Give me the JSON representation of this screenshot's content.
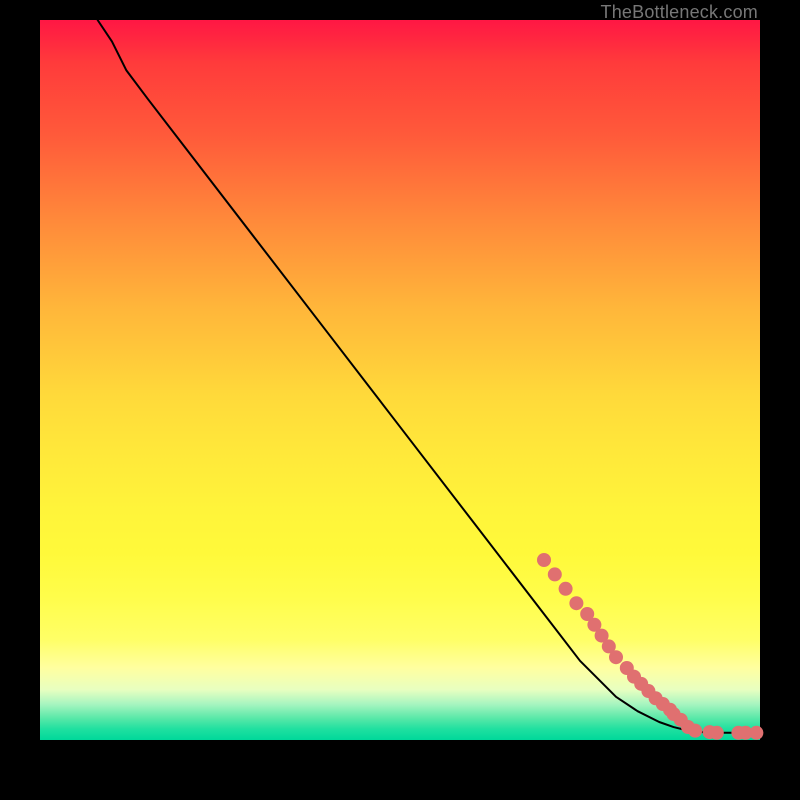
{
  "attribution": "TheBottleneck.com",
  "colors": {
    "dot": "#e07070",
    "curve": "#000000",
    "frame": "#000000"
  },
  "chart_data": {
    "type": "line",
    "title": "",
    "xlabel": "",
    "ylabel": "",
    "xlim": [
      0,
      100
    ],
    "ylim": [
      0,
      100
    ],
    "grid": false,
    "legend": false,
    "curve": {
      "description": "Monotone decreasing bottleneck curve starting near (8,100), slight shoulder near x≈11, then near-linear descent to elbow around (88,2), then flat along y≈1 to x=100.",
      "x": [
        8,
        10,
        12,
        15,
        20,
        30,
        40,
        50,
        60,
        70,
        75,
        80,
        83,
        86,
        88,
        90,
        92,
        94,
        96,
        98,
        100
      ],
      "y": [
        100,
        97,
        93,
        89,
        82.5,
        69.5,
        56.5,
        43.5,
        30.5,
        17.5,
        11,
        6,
        4,
        2.5,
        1.8,
        1.3,
        1.1,
        1.0,
        1.0,
        1.0,
        1.0
      ]
    },
    "points": {
      "description": "Sample markers clustered along the lower-right portion of the curve and along the flat tail.",
      "x": [
        70,
        71.5,
        73,
        74.5,
        76,
        77,
        78,
        79,
        80,
        81.5,
        82.5,
        83.5,
        84.5,
        85.5,
        86.5,
        87.5,
        88,
        89,
        90,
        91,
        93,
        94,
        97,
        98,
        99.5
      ],
      "y": [
        25,
        23,
        21,
        19,
        17.5,
        16,
        14.5,
        13,
        11.5,
        10,
        8.8,
        7.8,
        6.8,
        5.8,
        5,
        4.2,
        3.6,
        2.8,
        1.8,
        1.3,
        1.1,
        1.0,
        1.0,
        1.0,
        1.0
      ]
    }
  }
}
